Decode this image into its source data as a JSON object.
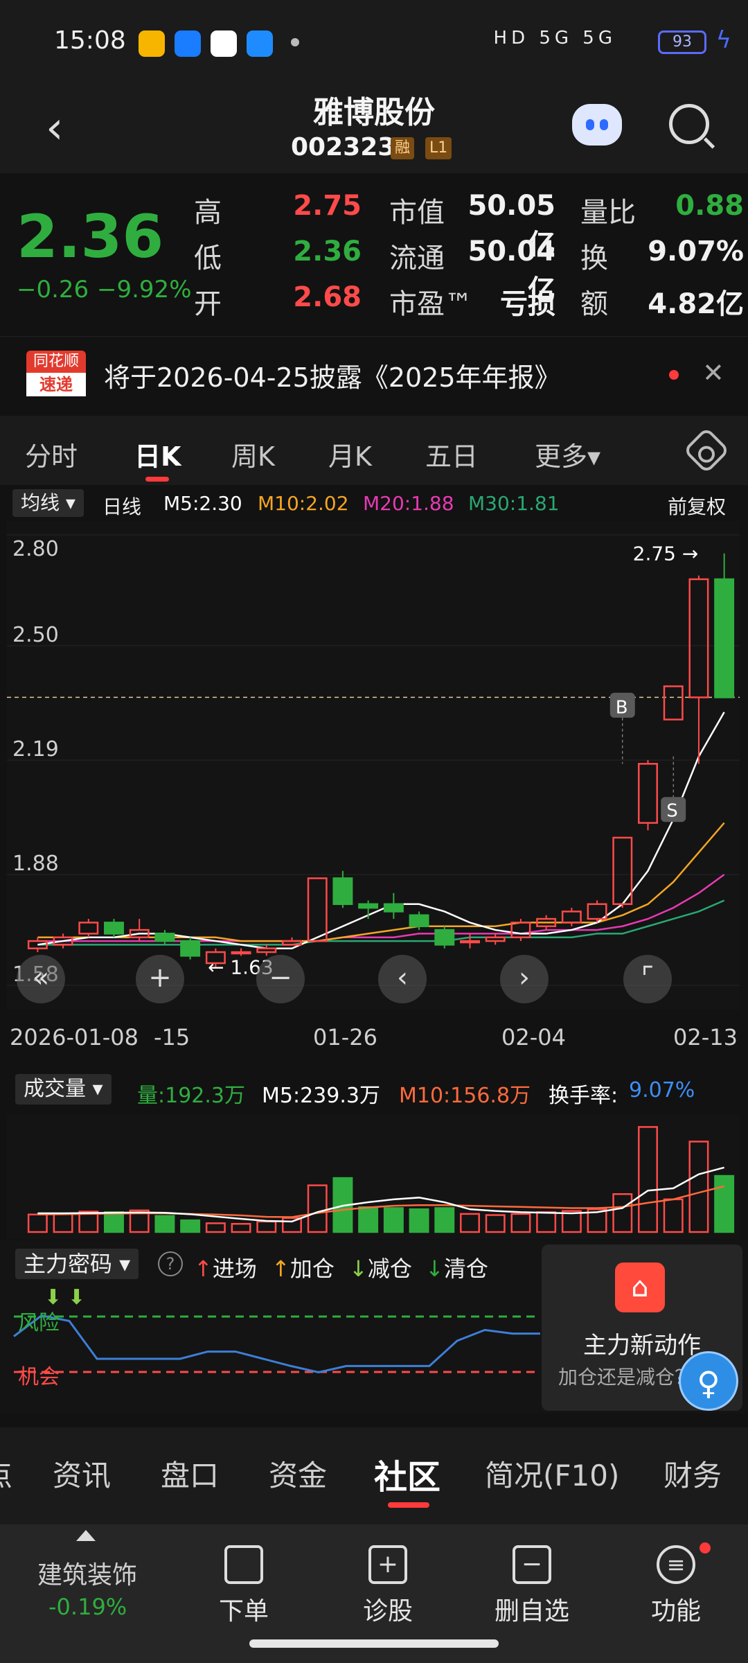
{
  "status_bar": {
    "time": "15:08",
    "indicators": "HD 5G 5G",
    "battery": "93"
  },
  "header": {
    "title": "雅博股份",
    "code": "002323",
    "tag_margin": "融",
    "tag_level": "L1"
  },
  "quote": {
    "price": "2.36",
    "change": "−0.26",
    "change_pct": "−9.92%",
    "rows": [
      {
        "l1": "高",
        "v1": "2.75",
        "l2": "市值",
        "v2": "50.05亿",
        "l3": "量比",
        "v3": "0.88"
      },
      {
        "l1": "低",
        "v1": "2.36",
        "l2": "流通",
        "v2": "50.04亿",
        "l3": "换",
        "v3": "9.07%"
      },
      {
        "l1": "开",
        "v1": "2.68",
        "l2": "市盈™",
        "v2": "亏损",
        "l3": "额",
        "v3": "4.82亿"
      }
    ]
  },
  "news": {
    "logo_top": "同花顺",
    "logo_bottom": "速递",
    "text": "将于2026-04-25披露《2025年年报》"
  },
  "period_tabs": [
    "分时",
    "日K",
    "周K",
    "月K",
    "五日",
    "更多▾"
  ],
  "ma_legend": {
    "type": "均线 ▾",
    "period": "日线",
    "m5": "M5:2.30",
    "m10": "M10:2.02",
    "m20": "M20:1.88",
    "m30": "M30:1.81",
    "adjust": "前复权"
  },
  "colors": {
    "up": "#ff4a4a",
    "down": "#2fae3f",
    "m5": "#ffffff",
    "m10": "#f5a623",
    "m20": "#e83ab3",
    "m30": "#2aa874",
    "turnover": "#3d8ef5"
  },
  "chart_data": {
    "type": "candlestick",
    "y_ticks": [
      "2.80",
      "2.50",
      "2.19",
      "1.88",
      "1.58"
    ],
    "ylim": [
      1.58,
      2.8
    ],
    "max_label": "2.75",
    "min_label": "1.63",
    "marker_b": "B",
    "marker_s": "S",
    "x_labels": [
      "2026-01-08",
      "-15",
      "01-26",
      "02-04",
      "02-13"
    ],
    "candles": [
      {
        "o": 1.68,
        "c": 1.7,
        "h": 1.71,
        "l": 1.67
      },
      {
        "o": 1.69,
        "c": 1.71,
        "h": 1.72,
        "l": 1.68
      },
      {
        "o": 1.72,
        "c": 1.75,
        "h": 1.76,
        "l": 1.71
      },
      {
        "o": 1.75,
        "c": 1.72,
        "h": 1.76,
        "l": 1.71
      },
      {
        "o": 1.71,
        "c": 1.73,
        "h": 1.76,
        "l": 1.7
      },
      {
        "o": 1.72,
        "c": 1.7,
        "h": 1.73,
        "l": 1.69
      },
      {
        "o": 1.7,
        "c": 1.66,
        "h": 1.71,
        "l": 1.65
      },
      {
        "o": 1.64,
        "c": 1.67,
        "h": 1.68,
        "l": 1.63
      },
      {
        "o": 1.67,
        "c": 1.67,
        "h": 1.68,
        "l": 1.66
      },
      {
        "o": 1.67,
        "c": 1.68,
        "h": 1.69,
        "l": 1.66
      },
      {
        "o": 1.69,
        "c": 1.7,
        "h": 1.71,
        "l": 1.69
      },
      {
        "o": 1.7,
        "c": 1.87,
        "h": 1.87,
        "l": 1.7
      },
      {
        "o": 1.87,
        "c": 1.8,
        "h": 1.89,
        "l": 1.79
      },
      {
        "o": 1.8,
        "c": 1.79,
        "h": 1.81,
        "l": 1.76
      },
      {
        "o": 1.8,
        "c": 1.78,
        "h": 1.83,
        "l": 1.76
      },
      {
        "o": 1.77,
        "c": 1.74,
        "h": 1.78,
        "l": 1.73
      },
      {
        "o": 1.73,
        "c": 1.69,
        "h": 1.74,
        "l": 1.68
      },
      {
        "o": 1.7,
        "c": 1.7,
        "h": 1.72,
        "l": 1.68
      },
      {
        "o": 1.7,
        "c": 1.71,
        "h": 1.72,
        "l": 1.69
      },
      {
        "o": 1.71,
        "c": 1.75,
        "h": 1.76,
        "l": 1.7
      },
      {
        "o": 1.74,
        "c": 1.76,
        "h": 1.77,
        "l": 1.73
      },
      {
        "o": 1.75,
        "c": 1.78,
        "h": 1.79,
        "l": 1.74
      },
      {
        "o": 1.76,
        "c": 1.8,
        "h": 1.81,
        "l": 1.75
      },
      {
        "o": 1.8,
        "c": 1.98,
        "h": 1.98,
        "l": 1.79
      },
      {
        "o": 2.02,
        "c": 2.18,
        "h": 2.19,
        "l": 2.0
      },
      {
        "o": 2.3,
        "c": 2.39,
        "h": 2.39,
        "l": 2.3
      },
      {
        "o": 2.36,
        "c": 2.68,
        "h": 2.69,
        "l": 2.18
      },
      {
        "o": 2.68,
        "c": 2.36,
        "h": 2.75,
        "l": 2.36
      }
    ],
    "ma5": [
      1.69,
      1.7,
      1.71,
      1.71,
      1.72,
      1.72,
      1.71,
      1.7,
      1.69,
      1.68,
      1.68,
      1.71,
      1.74,
      1.77,
      1.8,
      1.8,
      1.78,
      1.75,
      1.73,
      1.72,
      1.72,
      1.73,
      1.75,
      1.8,
      1.89,
      2.03,
      2.2,
      2.32
    ],
    "ma10": [
      1.71,
      1.71,
      1.71,
      1.71,
      1.71,
      1.71,
      1.71,
      1.71,
      1.7,
      1.7,
      1.7,
      1.7,
      1.71,
      1.72,
      1.73,
      1.74,
      1.74,
      1.74,
      1.74,
      1.75,
      1.75,
      1.75,
      1.75,
      1.77,
      1.8,
      1.86,
      1.94,
      2.02
    ],
    "ma20": [
      1.7,
      1.7,
      1.7,
      1.7,
      1.7,
      1.7,
      1.7,
      1.7,
      1.7,
      1.7,
      1.7,
      1.7,
      1.71,
      1.71,
      1.71,
      1.72,
      1.72,
      1.72,
      1.72,
      1.72,
      1.73,
      1.73,
      1.73,
      1.74,
      1.76,
      1.79,
      1.83,
      1.88
    ],
    "ma30": [
      1.69,
      1.69,
      1.69,
      1.69,
      1.69,
      1.69,
      1.69,
      1.69,
      1.69,
      1.69,
      1.69,
      1.7,
      1.7,
      1.7,
      1.7,
      1.7,
      1.7,
      1.71,
      1.71,
      1.71,
      1.71,
      1.71,
      1.72,
      1.72,
      1.74,
      1.76,
      1.78,
      1.81
    ],
    "volume": [
      60,
      62,
      70,
      68,
      74,
      55,
      40,
      30,
      28,
      36,
      48,
      160,
      185,
      85,
      82,
      78,
      82,
      62,
      58,
      62,
      68,
      72,
      78,
      130,
      360,
      112,
      310,
      192.3
    ],
    "vol_ma5": [
      64,
      64,
      65,
      66,
      67,
      66,
      61,
      53,
      45,
      38,
      36,
      68,
      90,
      102,
      112,
      118,
      102,
      78,
      72,
      68,
      66,
      64,
      68,
      82,
      142,
      150,
      198,
      221
    ],
    "vol_ma10": [
      60,
      61,
      62,
      63,
      64,
      64,
      62,
      60,
      57,
      52,
      51,
      65,
      76,
      84,
      90,
      92,
      92,
      90,
      88,
      86,
      84,
      82,
      82,
      86,
      100,
      112,
      135,
      156.8
    ]
  },
  "volume_legend": {
    "type": "成交量 ▾",
    "vol": "量:192.3万",
    "m5": "M5:239.3万",
    "m10": "M10:156.8万",
    "turnover_label": "换手率:",
    "turnover": "9.07%"
  },
  "main_force": {
    "title": "主力密码 ▾",
    "help": "?",
    "legend": [
      {
        "arrow": "↑",
        "label": "进场",
        "color": "#ff4a4a"
      },
      {
        "arrow": "↑",
        "label": "加仓",
        "color": "#f5a623"
      },
      {
        "arrow": "↓",
        "label": "减仓",
        "color": "#8bd04a"
      },
      {
        "arrow": "↓",
        "label": "清仓",
        "color": "#2fae3f"
      }
    ],
    "risk_label": "风险",
    "chance_label": "机会",
    "line": [
      0.55,
      0.78,
      0.72,
      0.3,
      0.3,
      0.3,
      0.3,
      0.38,
      0.38,
      0.3,
      0.22,
      0.15,
      0.22,
      0.22,
      0.22,
      0.22,
      0.5,
      0.62,
      0.58,
      0.58
    ]
  },
  "promo": {
    "title": "主力新动作",
    "subtitle": "加仓还是减仓？"
  },
  "bottom_tabs": [
    "点",
    "资讯",
    "盘口",
    "资金",
    "社区",
    "简况(F10)",
    "财务"
  ],
  "actions": {
    "sector": "建筑装饰",
    "sector_change": "-0.19%",
    "buttons": [
      "下单",
      "诊股",
      "删自选",
      "功能"
    ]
  }
}
